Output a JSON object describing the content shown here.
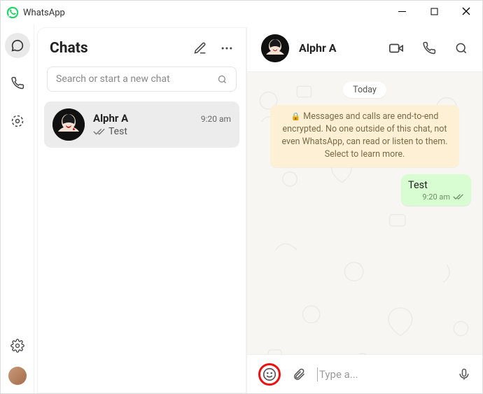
{
  "app": {
    "title": "WhatsApp"
  },
  "panel": {
    "title": "Chats",
    "search_placeholder": "Search or start a new chat"
  },
  "chat_item": {
    "name": "Alphr A",
    "time": "9:20 am",
    "preview": "Test"
  },
  "conversation": {
    "contact": "Alphr A",
    "date_label": "Today",
    "encryption_notice": "Messages and calls are end-to-end encrypted. No one outside of this chat, not even WhatsApp, can read or listen to them. Select to learn more.",
    "message": {
      "text": "Test",
      "time": "9:20 am"
    },
    "input_placeholder": "Type a..."
  }
}
